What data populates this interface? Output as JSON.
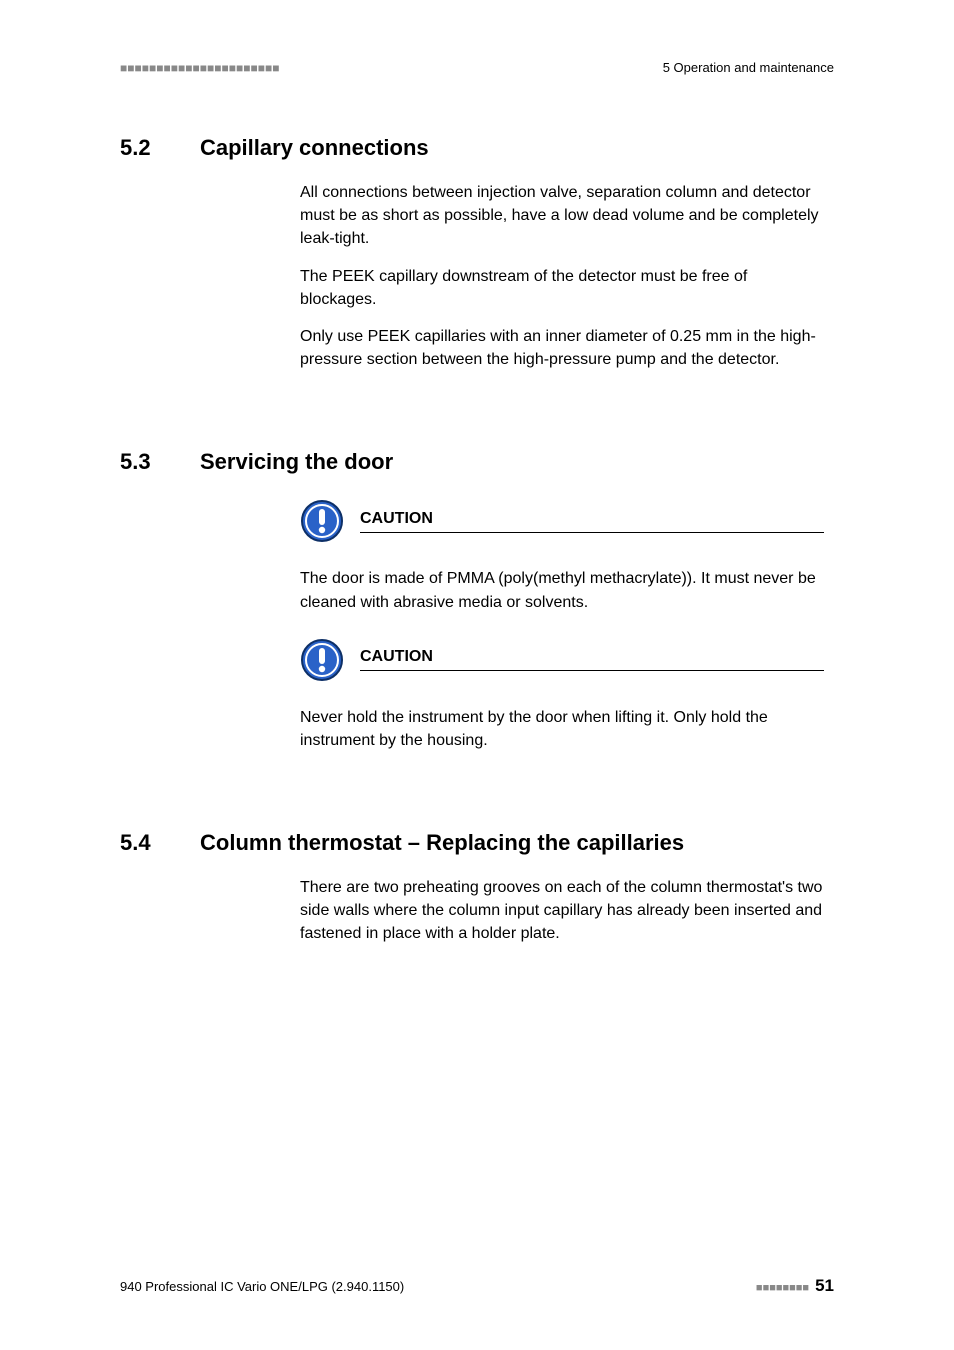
{
  "header": {
    "left_marks": "■■■■■■■■■■■■■■■■■■■■■■",
    "right": "5 Operation and maintenance"
  },
  "sections": {
    "s52": {
      "num": "5.2",
      "title": "Capillary connections",
      "p1": "All connections between injection valve, separation column and detector must be as short as possible, have a low dead volume and be completely leak-tight.",
      "p2": "The PEEK capillary downstream of the detector must be free of blockages.",
      "p3": "Only use PEEK capillaries with an inner diameter of 0.25 mm in the high-pressure section between the high-pressure pump and the detector."
    },
    "s53": {
      "num": "5.3",
      "title": "Servicing the door",
      "c1_label": "CAUTION",
      "c1_body": "The door is made of PMMA (poly(methyl methacrylate)). It must never be cleaned with abrasive media or solvents.",
      "c2_label": "CAUTION",
      "c2_body": "Never hold the instrument by the door when lifting it. Only hold the instrument by the housing."
    },
    "s54": {
      "num": "5.4",
      "title": "Column thermostat – Replacing the capillaries",
      "p1": "There are two preheating grooves on each of the column thermostat's two side walls where the column input capillary has already been inserted and fastened in place with a holder plate."
    }
  },
  "footer": {
    "left": "940 Professional IC Vario ONE/LPG (2.940.1150)",
    "marks": "■■■■■■■■",
    "page": "51"
  }
}
